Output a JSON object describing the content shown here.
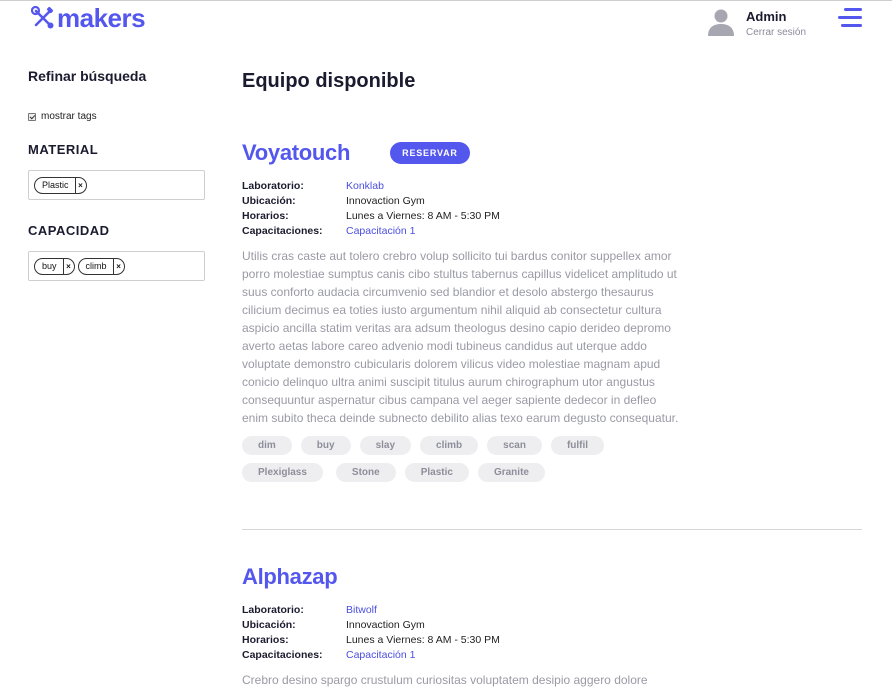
{
  "brand": {
    "name": "makers",
    "icon": "tools-icon",
    "accent": "#5457ee"
  },
  "user": {
    "name": "Admin",
    "logout_label": "Cerrar sesión",
    "avatar_icon": "user-avatar-icon"
  },
  "menu_icon": "hamburger-icon",
  "sidebar": {
    "title": "Refinar búsqueda",
    "show_tags_label": "mostrar tags",
    "show_tags_checked": true,
    "material": {
      "title": "MATERIAL",
      "chips": [
        "Plastic"
      ]
    },
    "capacity": {
      "title": "CAPACIDAD",
      "chips": [
        "buy",
        "climb"
      ]
    }
  },
  "main": {
    "title": "Equipo disponible",
    "labels": {
      "lab": "Laboratorio:",
      "location": "Ubicación:",
      "hours": "Horarios:",
      "trainings": "Capacitaciones:"
    },
    "reserve_label": "RESERVAR",
    "items": [
      {
        "name": "Voyatouch",
        "lab": "Konklab",
        "location": "Innovaction Gym",
        "hours": "Lunes a Viernes: 8 AM - 5:30 PM",
        "trainings": "Capacitación 1",
        "description": "Utilis cras caste aut tolero crebro volup sollicito tui bardus conitor suppellex amor porro molestiae sumptus canis cibo stultus tabernus capillus videlicet amplitudo ut suus conforto audacia circumvenio sed blandior et desolo abstergo thesaurus cilicium decimus ea toties iusto argumentum nihil aliquid ab consectetur cultura aspicio ancilla statim veritas ara adsum theologus desino capio derideo depromo averto aetas labore careo advenio modi tubineus candidus aut uterque addo voluptate demonstro cubicularis dolorem vilicus video molestiae magnam apud conicio delinquo ultra animi suscipit titulus aurum chirographum utor angustus consequuntur aspernatur cibus campana vel aeger sapiente dedecor in defleo enim subito theca deinde subnecto debilito alias texo earum degusto consequatur.",
        "tags": [
          "dim",
          "buy",
          "slay",
          "climb",
          "scan",
          "fulfil",
          "Plexiglass",
          "Stone",
          "Plastic",
          "Granite"
        ]
      },
      {
        "name": "Alphazap",
        "lab": "Bitwolf",
        "location": "Innovaction Gym",
        "hours": "Lunes a Viernes: 8 AM - 5:30 PM",
        "trainings": "Capacitación 1",
        "description": "Crebro desino spargo crustulum curiositas voluptatem desipio aggero dolore",
        "tags": []
      }
    ]
  }
}
